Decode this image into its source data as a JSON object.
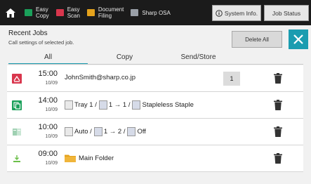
{
  "topbar": {
    "items": [
      {
        "label_1": "Easy",
        "label_2": "Copy",
        "icon": "copy-icon",
        "color": "#1aa05a"
      },
      {
        "label_1": "Easy",
        "label_2": "Scan",
        "icon": "scan-icon",
        "color": "#d9364d"
      },
      {
        "label_1": "Document",
        "label_2": "Filing",
        "icon": "filing-icon",
        "color": "#e4a21c"
      },
      {
        "label_1": "Sharp OSA",
        "label_2": "",
        "icon": "osa-icon",
        "color": "#9aa0a8"
      }
    ],
    "system_info": "System Info.",
    "job_status": "Job Status"
  },
  "header": {
    "title": "Recent Jobs",
    "subtitle": "Call settings of selected job.",
    "delete_all": "Delete All"
  },
  "tabs": [
    "All",
    "Copy",
    "Send/Store"
  ],
  "jobs": [
    {
      "time": "15:00",
      "date": "10/09",
      "text": "JohnSmith@sharp.co.jp",
      "count": "1",
      "icon": "scan-job-icon"
    },
    {
      "time": "14:00",
      "date": "10/09",
      "tray": "Tray 1 /",
      "duplex": "1 → 1 /",
      "finish": "Stapleless Staple",
      "icon": "copy-job-icon"
    },
    {
      "time": "10:00",
      "date": "10/09",
      "tray": "Auto /",
      "duplex": "1 → 2 /",
      "finish": "Off",
      "icon": "copy-job-icon"
    },
    {
      "time": "09:00",
      "date": "10/09",
      "text": "Main Folder",
      "icon": "store-job-icon"
    }
  ],
  "colors": {
    "accent": "#1a9cb0",
    "scan": "#d9364d",
    "copy": "#1aa05a",
    "folder": "#e4a21c"
  }
}
